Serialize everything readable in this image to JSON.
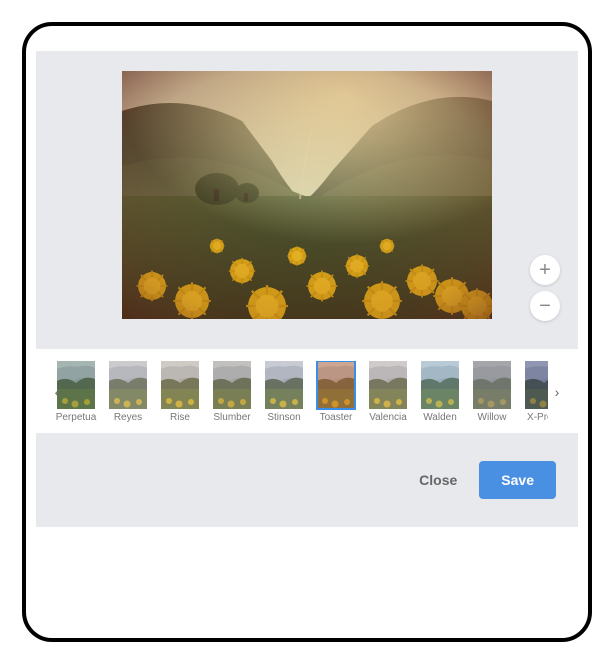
{
  "filters": [
    {
      "name": "Perpetua",
      "selected": false,
      "tint": "rgba(100,140,110,0.35)"
    },
    {
      "name": "Reyes",
      "selected": false,
      "tint": "rgba(210,200,190,0.35)"
    },
    {
      "name": "Rise",
      "selected": false,
      "tint": "rgba(230,200,150,0.3)"
    },
    {
      "name": "Slumber",
      "selected": false,
      "tint": "rgba(180,170,140,0.35)"
    },
    {
      "name": "Stinson",
      "selected": false,
      "tint": "rgba(200,200,200,0.25)"
    },
    {
      "name": "Toaster",
      "selected": true,
      "tint": "rgba(210,120,60,0.45)"
    },
    {
      "name": "Valencia",
      "selected": false,
      "tint": "rgba(230,200,170,0.3)"
    },
    {
      "name": "Walden",
      "selected": false,
      "tint": "rgba(150,200,210,0.3)"
    },
    {
      "name": "Willow",
      "selected": false,
      "tint": "rgba(140,140,140,0.6)"
    },
    {
      "name": "X-Pro II",
      "selected": false,
      "tint": "rgba(60,70,120,0.4)"
    }
  ],
  "buttons": {
    "close": "Close",
    "save": "Save"
  },
  "icons": {
    "plus": "+",
    "minus": "−",
    "left": "‹",
    "right": "›"
  }
}
